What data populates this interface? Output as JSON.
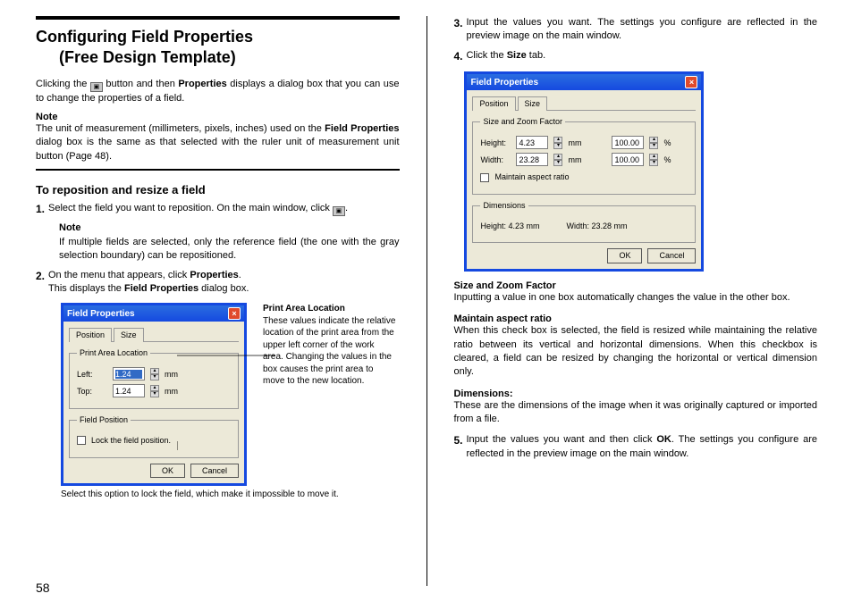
{
  "page_number": "58",
  "left": {
    "title_l1": "Configuring Field Properties",
    "title_l2": "(Free Design Template)",
    "intro_a": "Clicking the ",
    "intro_b": " button and then ",
    "intro_b_bold": "Properties",
    "intro_c": " displays a dialog box that you can use to change the properties of a field.",
    "note_head": "Note",
    "note_body_a": "The unit of measurement (millimeters, pixels, inches) used on the ",
    "note_body_bold": "Field Properties",
    "note_body_b": " dialog box is the same as that selected with the ruler unit of measurement unit button (Page 48).",
    "section_head": "To reposition and resize a field",
    "step1": "Select the field you want to reposition. On the main window, click ",
    "step1_note_head": "Note",
    "step1_note": "If multiple fields are selected, only the reference field (the one with the gray selection boundary) can be repositioned.",
    "step2_a": "On the menu that appears, click ",
    "step2_bold": "Properties",
    "step2_b": ".",
    "step2_c": "This displays the ",
    "step2_c_bold": "Field Properties",
    "step2_d": " dialog box.",
    "fig1_side_head": "Print Area Location",
    "fig1_side_body": "These values indicate the relative location of the print area from the upper left corner of the work area. Changing the values in the box causes the print area to move to the new location.",
    "fig1_caption": "Select this option to lock the field, which make it impossible to move it."
  },
  "right": {
    "step3": "Input the values you want. The settings you configure are reflected in the preview image on the main window.",
    "step4_a": "Click the ",
    "step4_bold": "Size",
    "step4_b": " tab.",
    "d1_head": "Size and Zoom Factor",
    "d1_body": "Inputting a value in one box automatically changes the value in the other box.",
    "d2_head": "Maintain aspect ratio",
    "d2_body": "When this check box is selected, the field is resized while maintaining the relative ratio between its vertical and horizontal dimensions. When this checkbox is cleared, a field can be resized by changing the horizontal or vertical dimension only.",
    "d3_head": "Dimensions:",
    "d3_body": "These are the dimensions of the image when it was originally captured or imported from a file.",
    "step5_a": "Input the values you want and then click ",
    "step5_bold": "OK",
    "step5_b": ". The settings you configure are reflected in the preview image on the main window."
  },
  "dlg": {
    "title": "Field Properties",
    "tab_position": "Position",
    "tab_size": "Size",
    "ok": "OK",
    "cancel": "Cancel",
    "pos": {
      "group": "Print Area Location",
      "left_lbl": "Left:",
      "left_val": "1.24",
      "top_lbl": "Top:",
      "top_val": "1.24",
      "unit": "mm",
      "group2": "Field Position",
      "lock": "Lock the field position."
    },
    "size": {
      "group": "Size and Zoom Factor",
      "h_lbl": "Height:",
      "h_val": "4.23",
      "w_lbl": "Width:",
      "w_val": "23.28",
      "unit": "mm",
      "pct": "100.00",
      "pct_sym": "%",
      "maintain": "Maintain aspect ratio",
      "group2": "Dimensions",
      "dim_h": "Height:   4.23 mm",
      "dim_w": "Width:   23.28 mm"
    }
  }
}
